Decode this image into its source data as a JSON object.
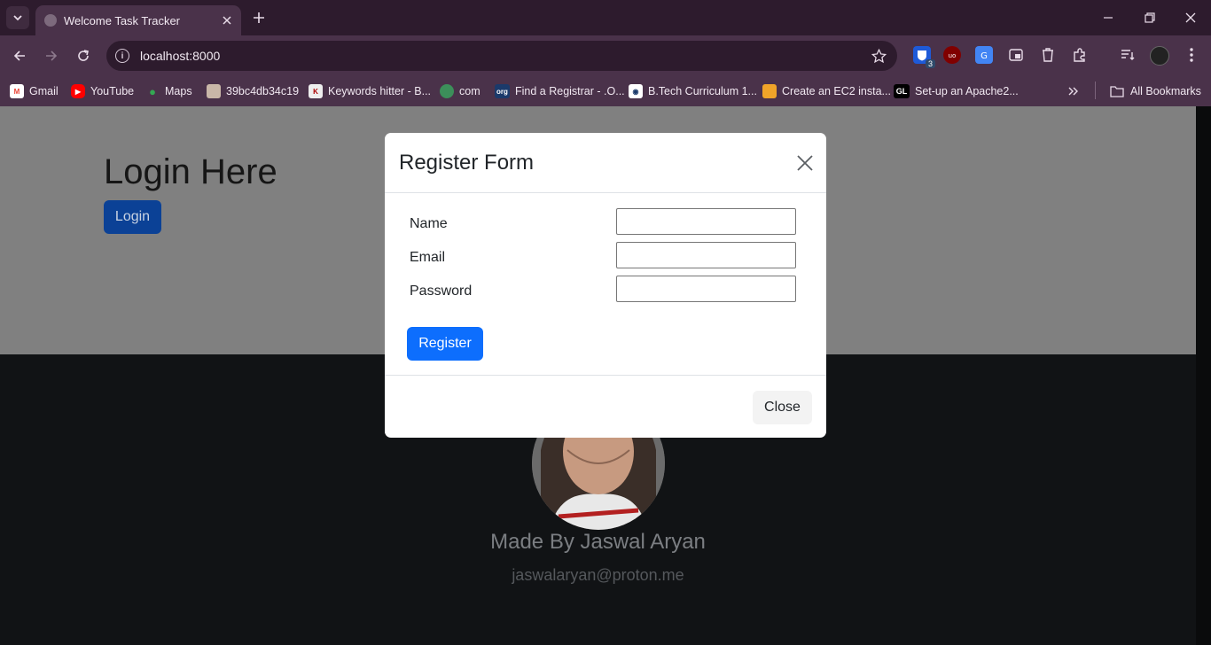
{
  "browser": {
    "tab_title": "Welcome Task Tracker",
    "url": "localhost:8000",
    "extensions": [
      "bitwarden-icon",
      "ublock-icon",
      "translate-icon",
      "media-icon",
      "trash-icon",
      "puzzle-icon"
    ],
    "extension_badge": "3",
    "bookmarks": [
      {
        "label": "Gmail",
        "icon": "gmail-icon"
      },
      {
        "label": "YouTube",
        "icon": "youtube-icon"
      },
      {
        "label": "Maps",
        "icon": "maps-icon"
      },
      {
        "label": "39bc4db34c19",
        "icon": "page-icon"
      },
      {
        "label": "Keywords hitter - B...",
        "icon": "keywords-icon"
      },
      {
        "label": "com",
        "icon": "globe-icon"
      },
      {
        "label": "Find a Registrar - .O...",
        "icon": "org-icon"
      },
      {
        "label": "B.Tech Curriculum 1...",
        "icon": "curriculum-icon"
      },
      {
        "label": "Create an EC2 insta...",
        "icon": "aws-icon"
      },
      {
        "label": "Set-up an Apache2...",
        "icon": "gl-icon"
      }
    ],
    "bookmark_icon_texts": {
      "org": "org",
      "gl": "GL"
    },
    "all_bookmarks": "All Bookmarks"
  },
  "page": {
    "heading": "Login Here",
    "login_button": "Login",
    "footer_name": "Made By Jaswal Aryan",
    "footer_email": "jaswalaryan@proton.me"
  },
  "modal": {
    "title": "Register Form",
    "fields": [
      {
        "label": "Name",
        "value": ""
      },
      {
        "label": "Email",
        "value": ""
      },
      {
        "label": "Password",
        "value": ""
      }
    ],
    "register_button": "Register",
    "close_button": "Close"
  },
  "colors": {
    "primary": "#0d6efd",
    "browser_frame": "#4a324a",
    "footer_bg": "#111315"
  }
}
